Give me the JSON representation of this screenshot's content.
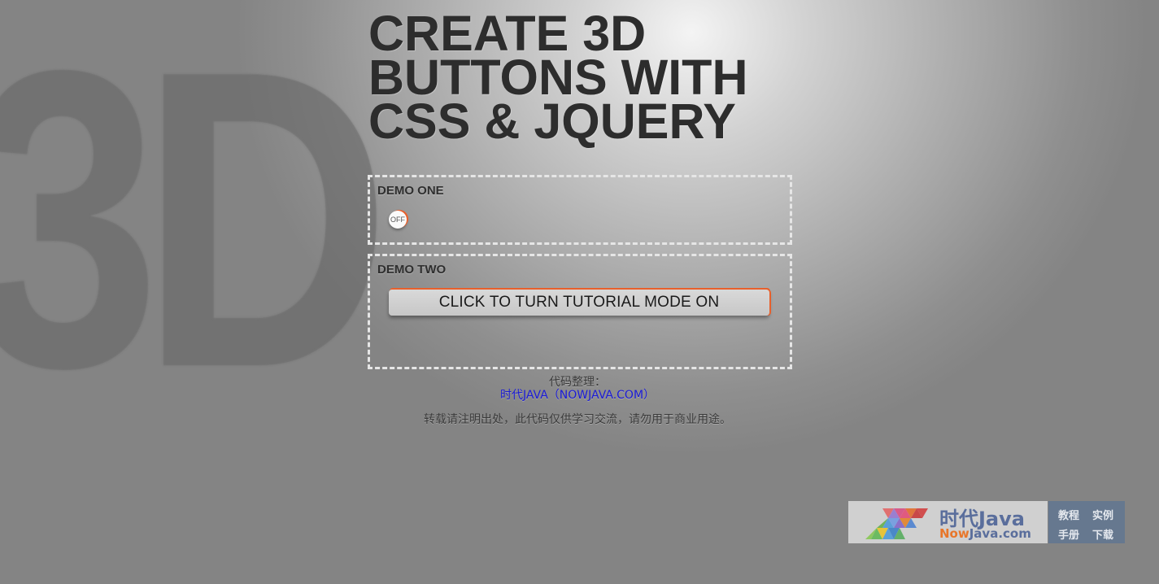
{
  "background": {
    "watermark_text": "3D"
  },
  "header": {
    "title_lines": [
      "CREATE 3D",
      "BUTTONS WITH",
      "CSS & JQUERY"
    ]
  },
  "demo_one": {
    "label": "DEMO ONE",
    "toggle_label": "OFF"
  },
  "demo_two": {
    "label": "DEMO TWO",
    "button_label": "CLICK TO TURN TUTORIAL MODE ON"
  },
  "credits": {
    "organized_by": "代码整理：",
    "site_link": "时代JAVA（NOWJAVA.COM）",
    "notice": "转载请注明出处，此代码仅供学习交流，请勿用于商业用途。"
  },
  "logo": {
    "name_cn": "时代Java",
    "domain_now": "Now",
    "domain_rest": "Java.com",
    "tags": [
      "教程",
      "实例",
      "手册",
      "下载"
    ]
  },
  "colors": {
    "accent": "#e8602c",
    "title": "#2d2d2d",
    "link": "#1a1ad6",
    "logo_blue": "#5a6e9c",
    "logo_orange": "#e8762a",
    "logo_panel": "#66788f"
  }
}
